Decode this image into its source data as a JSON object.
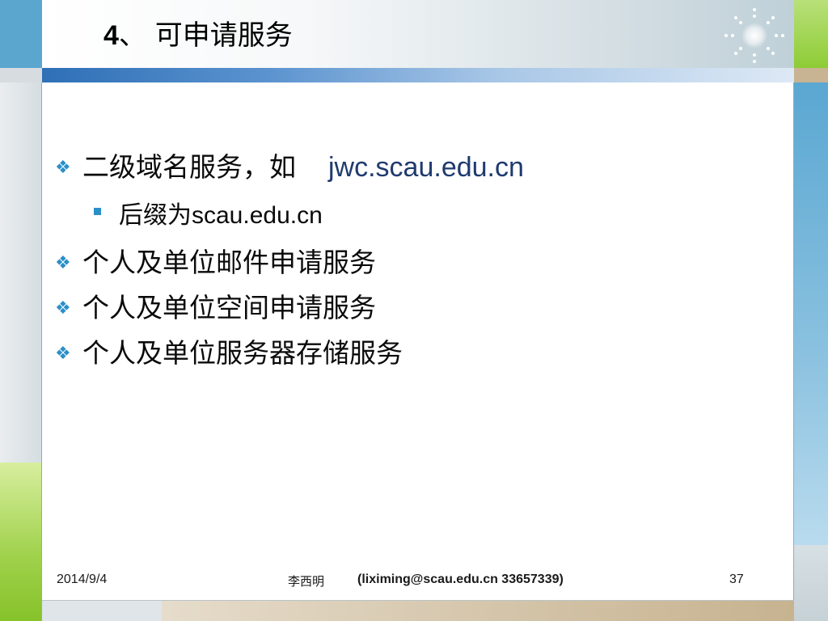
{
  "slide": {
    "title_number": "4",
    "title_text": "、 可申请服务",
    "bullets": [
      {
        "text": "二级域名服务，如",
        "extra": "jwc.scau.edu.cn"
      },
      {
        "sub": true,
        "text": "后缀为",
        "extra": "scau.edu.cn"
      },
      {
        "text": "个人及单位邮件申请服务"
      },
      {
        "text": "个人及单位空间申请服务"
      },
      {
        "text": "个人及单位服务器存储服务"
      }
    ],
    "footer": {
      "date": "2014/9/4",
      "author": "李西明",
      "contact": "(liximing@scau.edu.cn  33657339)",
      "page": "37"
    }
  },
  "icons": {
    "bullet_marker": "diamond-four-icon",
    "sub_marker": "square-icon",
    "sparkle": "sparkle-icon"
  },
  "colors": {
    "accent_blue": "#2a8fc8",
    "header_green": "#8dcc35"
  }
}
